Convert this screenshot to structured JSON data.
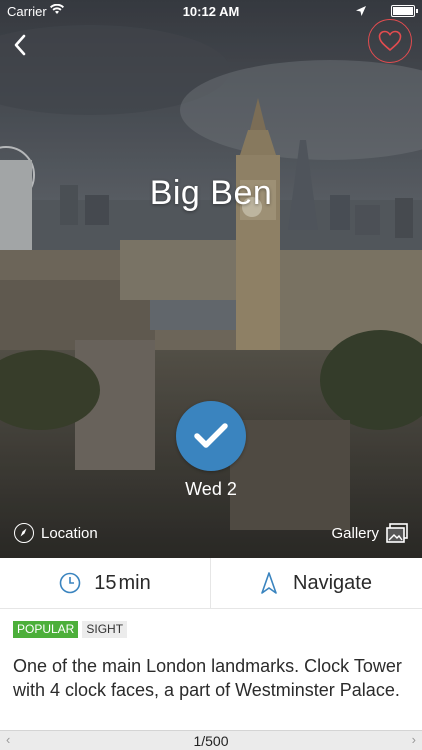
{
  "status_bar": {
    "carrier": "Carrier",
    "time": "10:12 AM",
    "battery_level": 1.0
  },
  "header": {
    "back_icon": "chevron-left-icon",
    "favorite_icon": "heart-icon",
    "title": "Big Ben"
  },
  "visit": {
    "check_icon": "checkmark-icon",
    "date": "Wed 2"
  },
  "hero_actions": {
    "location_label": "Location",
    "gallery_label": "Gallery"
  },
  "info_bar": {
    "duration_value": "15",
    "duration_unit": "min",
    "navigate_label": "Navigate"
  },
  "tags": {
    "popular": "POPULAR",
    "sight": "SIGHT"
  },
  "description": "One of the main London landmarks. Clock Tower with 4 clock faces, a part of Westminster Palace.",
  "pager": {
    "current": "1/500"
  },
  "colors": {
    "accent_blue": "#3a84bf",
    "favorite_red": "#e24c4f",
    "tag_green": "#4caf3a"
  }
}
